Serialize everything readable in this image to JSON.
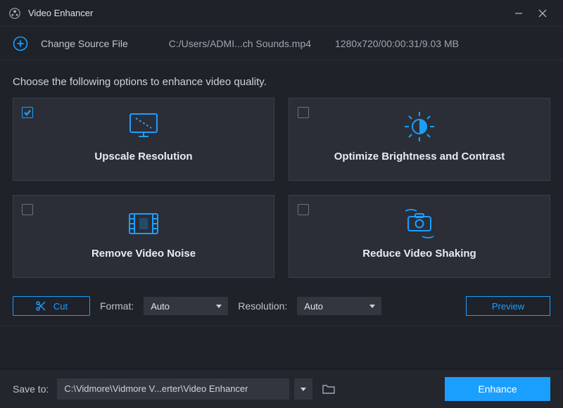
{
  "titlebar": {
    "title": "Video Enhancer"
  },
  "source": {
    "change_label": "Change Source File",
    "path": "C:/Users/ADMI...ch Sounds.mp4",
    "meta": "1280x720/00:00:31/9.03 MB"
  },
  "instruction": "Choose the following options to enhance video quality.",
  "cards": [
    {
      "title": "Upscale Resolution",
      "checked": true
    },
    {
      "title": "Optimize Brightness and Contrast",
      "checked": false
    },
    {
      "title": "Remove Video Noise",
      "checked": false
    },
    {
      "title": "Reduce Video Shaking",
      "checked": false
    }
  ],
  "toolbar": {
    "cut_label": "Cut",
    "format_label": "Format:",
    "format_value": "Auto",
    "resolution_label": "Resolution:",
    "resolution_value": "Auto",
    "preview_label": "Preview"
  },
  "savebar": {
    "label": "Save to:",
    "path": "C:\\Vidmore\\Vidmore V...erter\\Video Enhancer",
    "enhance_label": "Enhance"
  },
  "colors": {
    "accent": "#1a9fff"
  }
}
